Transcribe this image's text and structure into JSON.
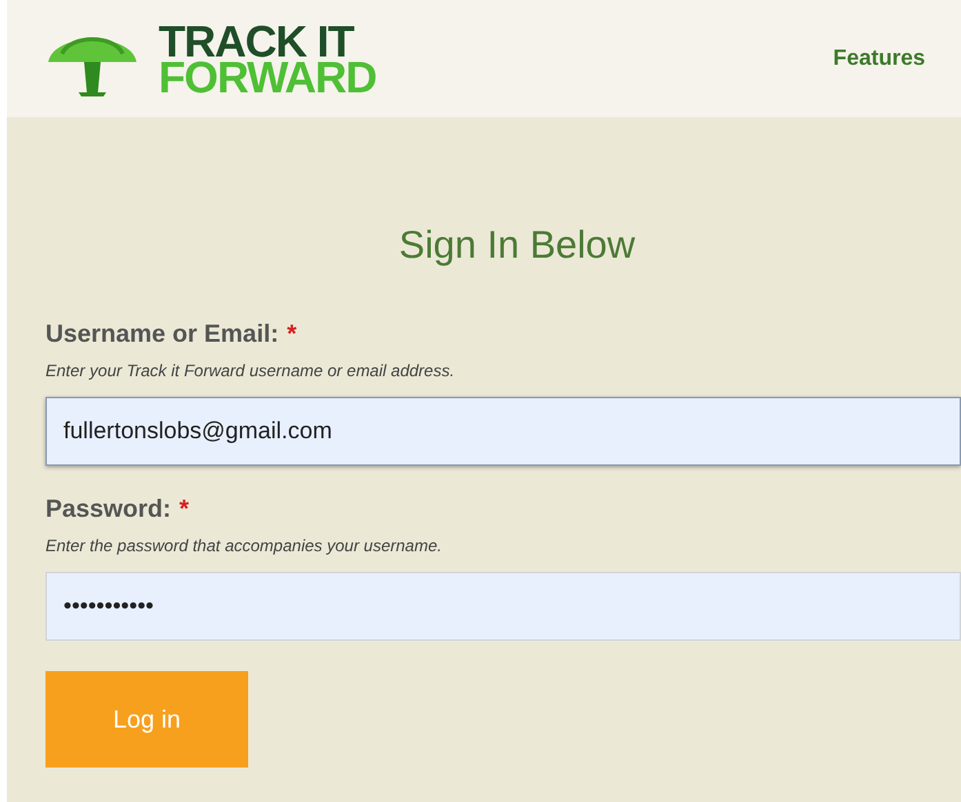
{
  "header": {
    "logo_line_1": "TRACK IT",
    "logo_line_2": "FORWARD",
    "nav": [
      "Features"
    ]
  },
  "form": {
    "title": "Sign In Below",
    "fields": [
      {
        "label": "Username or Email:",
        "required_mark": "*",
        "hint": "Enter your Track it Forward username or email address.",
        "value": "fullertonslobs@gmail.com",
        "focused": true
      },
      {
        "label": "Password:",
        "required_mark": "*",
        "hint": "Enter the password that accompanies your username.",
        "value": "•••••••••••",
        "focused": false
      }
    ],
    "submit": "Log in"
  }
}
